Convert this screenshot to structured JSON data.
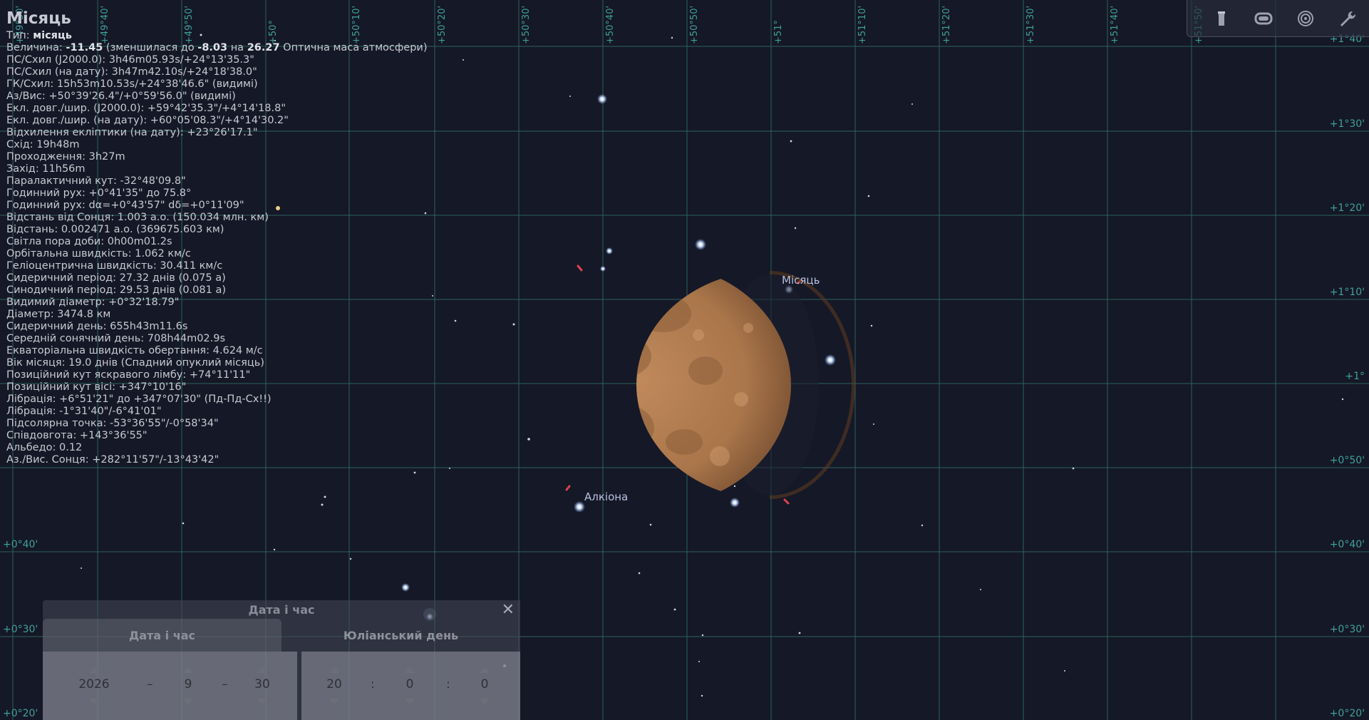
{
  "object_name": "Місяць",
  "info_lines": [
    {
      "k": "Тип: ",
      "b": "місяць",
      "r": ""
    },
    {
      "k": "Величина: ",
      "b": "-11.45",
      "r": " (зменшилася до ",
      "b2": "-8.03",
      "r2": " на ",
      "b3": "26.27",
      "r3": " Оптична маса атмосфери)"
    },
    {
      "k": "ПС/Схил (J2000.0): 3h46m05.93s/+24°13'35.3\""
    },
    {
      "k": "ПС/Схил (на дату): 3h47m42.10s/+24°18'38.0\""
    },
    {
      "k": "ГК/Схил: 15h53m10.53s/+24°38'46.6\" (видимі)"
    },
    {
      "k": "Аз/Вис: +50°39'26.4\"/+0°59'56.0\" (видимі)"
    },
    {
      "k": "Екл. довг./шир. (J2000.0): +59°42'35.3\"/+4°14'18.8\""
    },
    {
      "k": "Екл. довг./шир. (на дату): +60°05'08.3\"/+4°14'30.2\""
    },
    {
      "k": "Відхилення екліптики (на дату): +23°26'17.1\""
    },
    {
      "k": "Схід: 19h48m"
    },
    {
      "k": "Проходження: 3h27m"
    },
    {
      "k": "Захід: 11h56m"
    },
    {
      "k": "Паралактичний кут: -32°48'09.8\""
    },
    {
      "k": "Годинний рух: +0°41'35\" до 75.8°"
    },
    {
      "k": "Годинний рух: dα=+0°43'57\" dδ=+0°11'09\""
    },
    {
      "k": "Відстань від Сонця: 1.003 а.о. (150.034 млн. км)"
    },
    {
      "k": "Відстань: 0.002471 а.о. (369675.603 км)"
    },
    {
      "k": "Світла пора доби: 0h00m01.2s"
    },
    {
      "k": "Орбітальна швидкість: 1.062 км/с"
    },
    {
      "k": "Геліоцентрична швидкість: 30.411 км/с"
    },
    {
      "k": "Сидеричний період: 27.32 днів (0.075 а)"
    },
    {
      "k": "Синодичний період: 29.53 днів (0.081 а)"
    },
    {
      "k": "Видимий діаметр: +0°32'18.79\""
    },
    {
      "k": "Діаметр: 3474.8 км"
    },
    {
      "k": "Сидеричний день: 655h43m11.6s"
    },
    {
      "k": "Середній сонячний день: 708h44m02.9s"
    },
    {
      "k": "Екваторіальна швидкість обертання: 4.624 м/с"
    },
    {
      "k": "Вік місяця: 19.0 днів (Спадний опуклий місяць)"
    },
    {
      "k": "Позиційний кут яскравого лімбу: +74°11'11\""
    },
    {
      "k": "Позиційний кут вісі: +347°10'16\""
    },
    {
      "k": "Лібрація: +6°51'21\" до +347°07'30\" (Пд-Пд-Сх!!)"
    },
    {
      "k": "Лібрація: -1°31'40\"/-6°41'01\""
    },
    {
      "k": "Підсолярна точка: -53°36'55\"/-0°58'34\""
    },
    {
      "k": "Співдовгота: +143°36'55\""
    },
    {
      "k": "Альбедо: 0.12"
    },
    {
      "k": "Аз./Вис. Сонця: +282°11'57\"/-13°43'42\""
    }
  ],
  "top_axis_labels": [
    "+49°30'",
    "+49°40'",
    "+49°50'",
    "+50°",
    "+50°10'",
    "+50°20'",
    "+50°30'",
    "+50°40'",
    "+50°50'",
    "+51°",
    "+51°10'",
    "+51°20'",
    "+51°30'",
    "+51°40'",
    "+51°50'"
  ],
  "right_axis_labels": [
    "+1°40'",
    "+1°30'",
    "+1°20'",
    "+1°10'",
    "+1°",
    "+0°50'",
    "+0°40'",
    "+0°30'",
    "+0°20'"
  ],
  "left_axis_labels": [
    "+0°40'",
    "+0°30'",
    "+0°20'"
  ],
  "sky_labels": {
    "moon": "Місяць",
    "star": "Алкіона"
  },
  "toolbar_icons": [
    "flashlight-icon",
    "screen-icon",
    "target-icon",
    "wrench-icon"
  ],
  "date_panel": {
    "title": "Дата і час",
    "tab_date": "Дата і час",
    "tab_julian": "Юліанський день",
    "year": "2026",
    "month": "9",
    "day": "30",
    "hour": "20",
    "minute": "0",
    "second": "0",
    "date_sep": "–",
    "time_sep": ":"
  },
  "colors": {
    "grid": "#2f6f6a",
    "moon": "#b07a4e",
    "label": "#b7c1e0"
  }
}
